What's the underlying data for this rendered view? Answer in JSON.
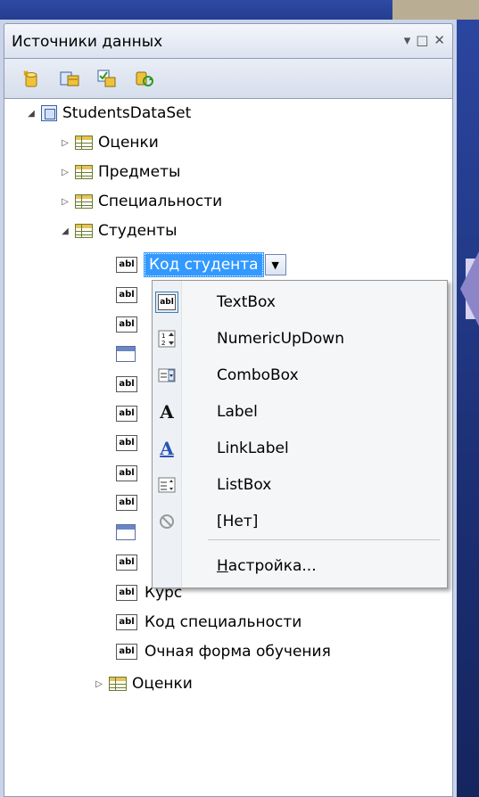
{
  "panel": {
    "title": "Источники данных",
    "title_buttons": [
      "▾",
      "□",
      "✕"
    ]
  },
  "toolbar": {
    "icons": [
      "add-datasource-icon",
      "edit-dataset-icon",
      "configure-icon",
      "refresh-icon"
    ]
  },
  "tree": {
    "dataset": "StudentsDataSet",
    "tables": [
      {
        "label": "Оценки",
        "expanded": false
      },
      {
        "label": "Предметы",
        "expanded": false
      },
      {
        "label": "Специальности",
        "expanded": false
      },
      {
        "label": "Студенты",
        "expanded": true
      }
    ],
    "selected_field": "Код студента",
    "visible_fields": [
      "Курс",
      "Код специальности",
      "Очная форма обучения"
    ],
    "nested_table": "Оценки"
  },
  "menu": {
    "items": [
      {
        "label": "TextBox",
        "icon": "textbox-icon",
        "checked": true
      },
      {
        "label": "NumericUpDown",
        "icon": "numericupdown-icon",
        "checked": false
      },
      {
        "label": "ComboBox",
        "icon": "combobox-icon",
        "checked": false
      },
      {
        "label": "Label",
        "icon": "label-icon",
        "checked": false
      },
      {
        "label": "LinkLabel",
        "icon": "linklabel-icon",
        "checked": false
      },
      {
        "label": "ListBox",
        "icon": "listbox-icon",
        "checked": false
      },
      {
        "label": "[Нет]",
        "icon": "none-icon",
        "checked": false
      }
    ],
    "customize_label": "Настройка..."
  },
  "icon_glyphs": {
    "abl": "abl"
  }
}
